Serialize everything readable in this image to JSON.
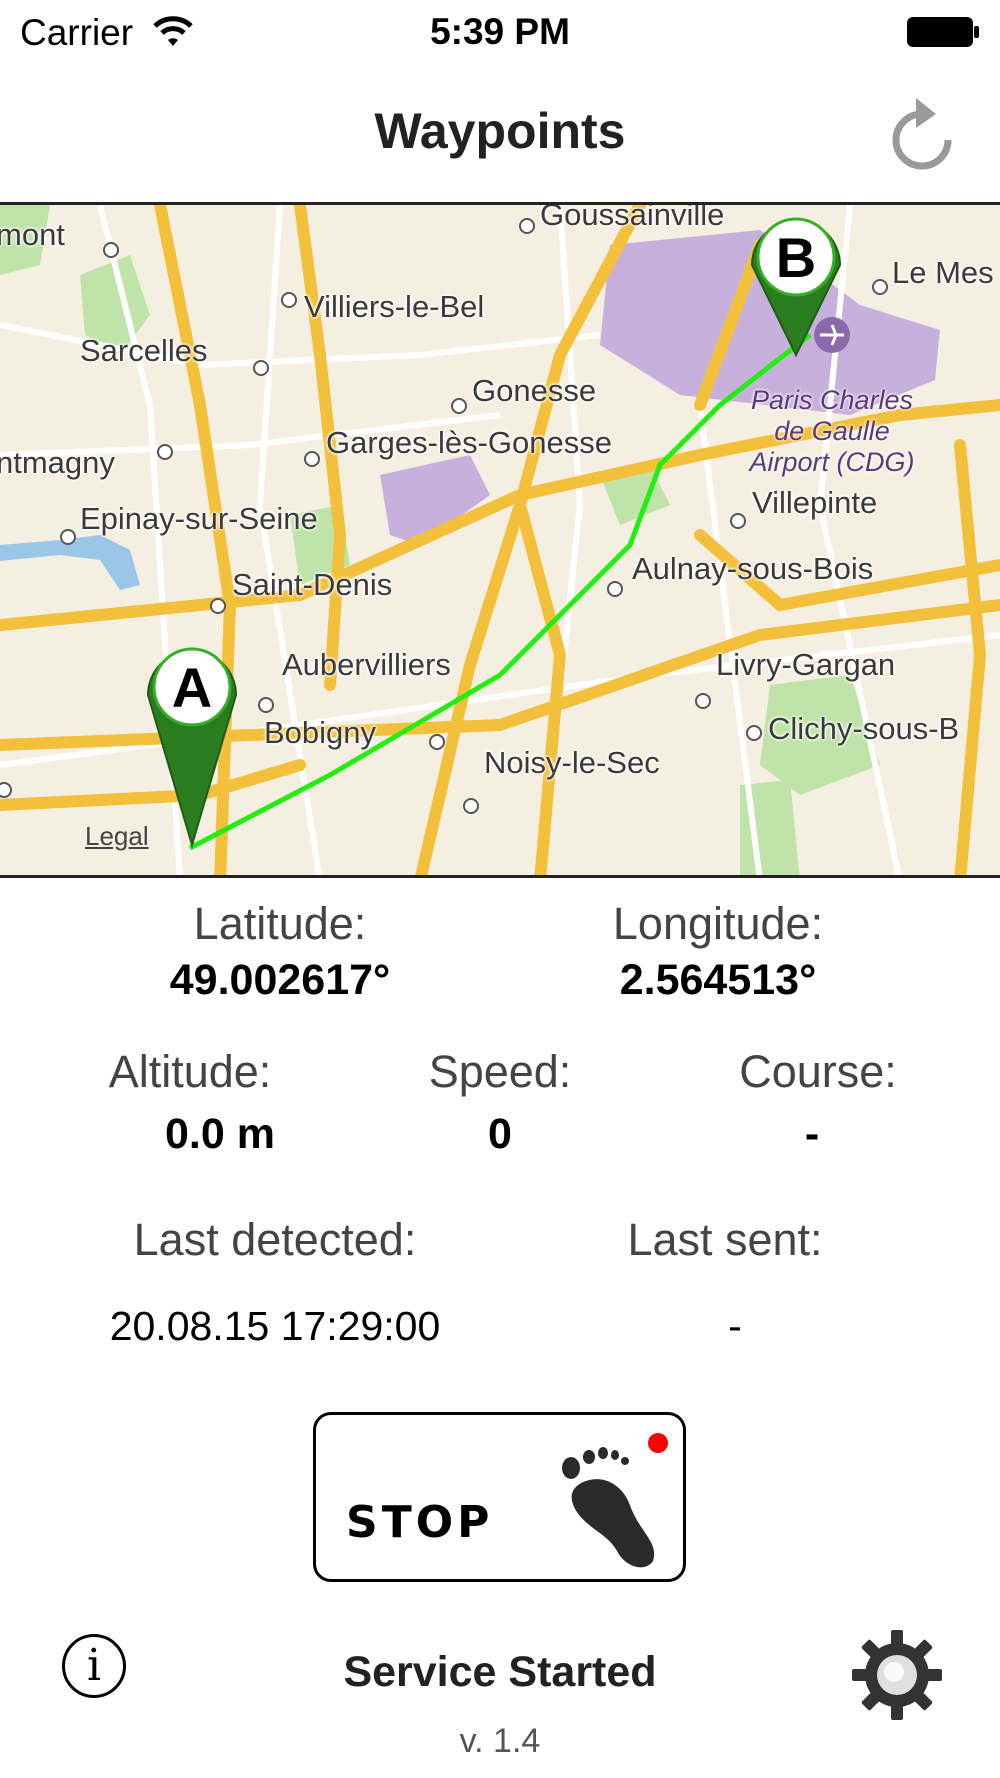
{
  "status_bar": {
    "carrier": "Carrier",
    "time": "5:39 PM"
  },
  "nav": {
    "title": "Waypoints",
    "refresh_icon": "refresh-icon"
  },
  "map": {
    "places": [
      "Goussainville",
      "mont",
      "Villiers-le-Bel",
      "Le Mes",
      "Sarcelles",
      "Gonesse",
      "Garges-lès-Gonesse",
      "ntmagny",
      "Villepinte",
      "Epinay-sur-Seine",
      "Aulnay-sous-Bois",
      "Saint-Denis",
      "Livry-Gargan",
      "Aubervilliers",
      "Clichy-sous-B",
      "Bobigny",
      "Noisy-le-Sec"
    ],
    "airport": "Paris Charles de Gaulle Airport (CDG)",
    "airport_line1": "Paris Charles",
    "airport_line2": "de Gaulle",
    "airport_line3": "Airport (CDG)",
    "pin_a": "A",
    "pin_b": "B",
    "legal": "Legal",
    "route_color": "#22ee11"
  },
  "position": {
    "latitude_label": "Latitude:",
    "latitude_value": "49.002617°",
    "longitude_label": "Longitude:",
    "longitude_value": "2.564513°"
  },
  "motion": {
    "altitude_label": "Altitude:",
    "altitude_value": "0.0 m",
    "speed_label": "Speed:",
    "speed_value": "0",
    "course_label": "Course:",
    "course_value": "-"
  },
  "timing": {
    "last_detected_label": "Last detected:",
    "last_detected_value": "20.08.15 17:29:00",
    "last_sent_label": "Last sent:",
    "last_sent_value": "-"
  },
  "controls": {
    "stop_label": "STOP",
    "recording_color": "#ff0000"
  },
  "footer": {
    "service_status": "Service Started",
    "version": "v. 1.4",
    "info_icon": "info-icon",
    "settings_icon": "gear-icon",
    "info_glyph": "i"
  }
}
